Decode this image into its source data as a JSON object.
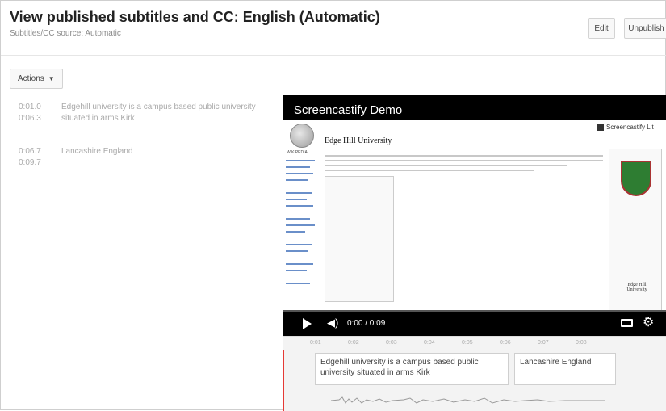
{
  "header": {
    "title": "View published subtitles and CC: English (Automatic)",
    "subtitle": "Subtitles/CC source: Automatic",
    "edit_label": "Edit",
    "unpublish_label": "Unpublish"
  },
  "actions": {
    "label": "Actions"
  },
  "cues": [
    {
      "start": "0:01.0",
      "end": "0:06.3",
      "text": "Edgehill university is a campus based public university situated in arms Kirk"
    },
    {
      "start": "0:06.7",
      "end": "0:09.7",
      "text": "Lancashire England"
    }
  ],
  "player": {
    "video_title": "Screencastify Demo",
    "time_display": "0:00 / 0:09",
    "page_heading": "Edge Hill University",
    "brand": "Screencastify Lit",
    "university_wordmark": "Edge Hill University"
  },
  "timeline": {
    "ticks": [
      "0:01",
      "0:02",
      "0:03",
      "0:04",
      "0:05",
      "0:06",
      "0:07",
      "0:08"
    ],
    "cue_boxes": [
      {
        "text": "Edgehill university is a campus based public university situated in arms Kirk"
      },
      {
        "text": "Lancashire England"
      }
    ]
  },
  "colors": {
    "accent_red": "#e53935",
    "player_bg": "#000000",
    "cue_text": "#aaaaaa"
  },
  "icons": [
    "caret-down-icon",
    "play-icon",
    "volume-icon",
    "captions-icon",
    "settings-gear-icon"
  ]
}
